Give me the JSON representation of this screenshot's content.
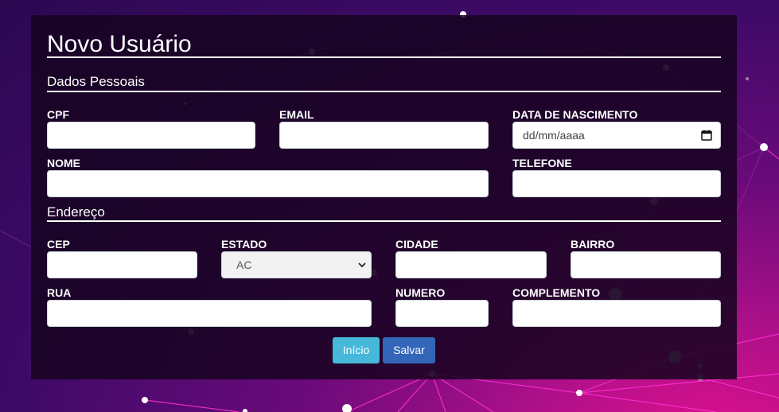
{
  "form": {
    "title": "Novo Usuário",
    "sections": {
      "personal": "Dados Pessoais",
      "address": "Endereço"
    },
    "labels": {
      "cpf": "CPF",
      "email": "EMAIL",
      "birth_date": "DATA DE NASCIMENTO",
      "name": "NOME",
      "phone": "TELEFONE",
      "cep": "CEP",
      "state": "ESTADO",
      "city": "CIDADE",
      "neighborhood": "BAIRRO",
      "street": "RUA",
      "number": "NUMERO",
      "complement": "COMPLEMENTO"
    },
    "values": {
      "cpf": "",
      "email": "",
      "birth_date_placeholder": "dd/mm/aaaa",
      "name": "",
      "phone": "",
      "cep": "",
      "state_selected": "AC",
      "city": "",
      "neighborhood": "",
      "street": "",
      "number": "",
      "complement": ""
    },
    "buttons": {
      "home": "Início",
      "save": "Salvar"
    }
  },
  "colors": {
    "home_button": "#46b8da",
    "save_button": "#3366b8",
    "panel": "#16041f"
  },
  "icons": {
    "date_picker": "calendar-icon",
    "select": "chevron-down-icon"
  }
}
